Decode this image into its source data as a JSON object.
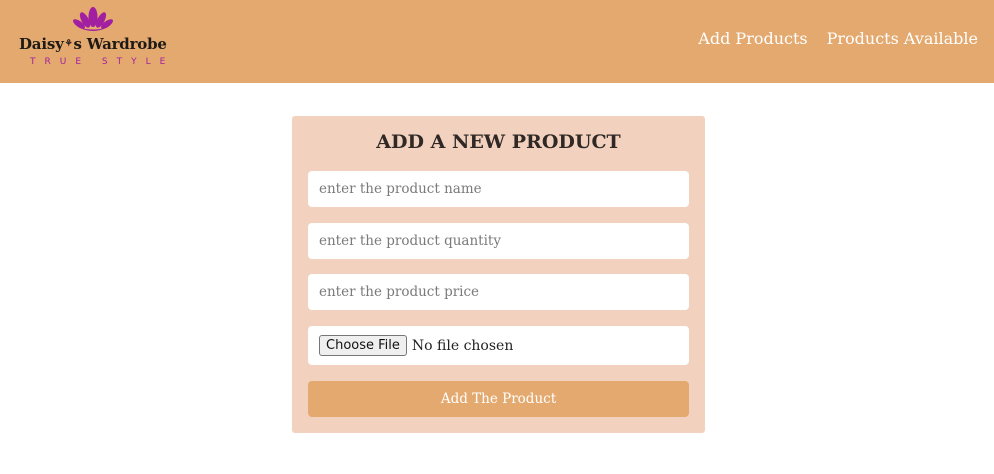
{
  "header": {
    "logo": {
      "icon": "lotus-icon",
      "brand_left": "Daisy",
      "brand_mark": "⚘",
      "brand_right": "s Wardrobe",
      "tagline": "TRUE STYLE"
    },
    "nav": [
      {
        "label": "Add Products"
      },
      {
        "label": "Products Available"
      }
    ]
  },
  "form": {
    "title": "ADD A NEW PRODUCT",
    "name_placeholder": "enter the product name",
    "quantity_placeholder": "enter the product quantity",
    "price_placeholder": "enter the product price",
    "file_button_label": "Choose File",
    "file_status": "No file chosen",
    "submit_label": "Add The Product"
  },
  "colors": {
    "header_bg": "#e4a96f",
    "card_bg": "#f2d2bf",
    "button_bg": "#e4a96f",
    "logo_accent": "#a11fa0"
  }
}
